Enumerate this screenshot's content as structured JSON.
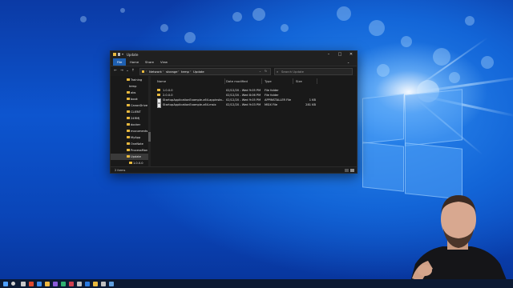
{
  "window": {
    "title": "Update"
  },
  "ribbon": {
    "tabs": [
      "File",
      "Home",
      "Share",
      "View"
    ]
  },
  "address": {
    "crumbs": [
      "Network",
      "storage",
      "temp",
      "Update"
    ]
  },
  "search": {
    "placeholder": "Search Update"
  },
  "nav": {
    "items": [
      {
        "label": "Training",
        "type": "folder"
      },
      {
        "label": "temp",
        "type": "plain"
      },
      {
        "label": "abs",
        "type": "folder"
      },
      {
        "label": "book",
        "type": "folder"
      },
      {
        "label": "CanonDrive",
        "type": "folder"
      },
      {
        "label": "CLIENT",
        "type": "folder"
      },
      {
        "label": "24RMJ",
        "type": "folder"
      },
      {
        "label": "docker",
        "type": "folder"
      },
      {
        "label": "mocuments",
        "type": "folder"
      },
      {
        "label": "MyApp",
        "type": "folder"
      },
      {
        "label": "OneNote",
        "type": "folder"
      },
      {
        "label": "ProcessMon",
        "type": "folder"
      },
      {
        "label": "Update",
        "type": "folder",
        "selected": true
      },
      {
        "label": "1.0.0.0",
        "type": "folder",
        "indent": true
      }
    ]
  },
  "files": {
    "columns": [
      "Name",
      "Date modified",
      "Type",
      "Size"
    ],
    "rows": [
      {
        "icon": "folder",
        "name": "1.0.0.0",
        "date": "02/12/20 - Wed 9:05 PM",
        "type": "File folder",
        "size": ""
      },
      {
        "icon": "folder",
        "name": "2.0.0.0",
        "date": "02/12/20 - Wed 8:06 PM",
        "type": "File folder",
        "size": ""
      },
      {
        "icon": "file",
        "name": "StartupApplicationExample-x64.appinsta...",
        "date": "02/12/20 - Wed 9:05 PM",
        "type": "APPINSTALLER File",
        "size": "1 KB"
      },
      {
        "icon": "file",
        "name": "StartupApplicationExample-x64.msix",
        "date": "02/12/20 - Wed 9:03 PM",
        "type": "MSIX File",
        "size": "281 KB"
      }
    ]
  },
  "status": {
    "item_count": "2 items"
  },
  "colors": {
    "file_tab": "#1e5fb0",
    "folder": "#e8b93f",
    "window_bg": "#191919",
    "taskbar": "#0c1a33"
  }
}
